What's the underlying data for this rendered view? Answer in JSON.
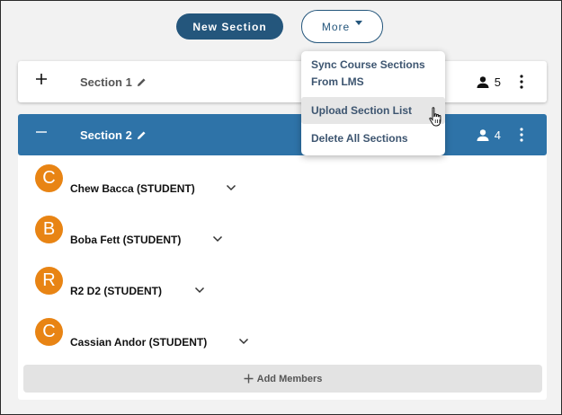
{
  "toolbar": {
    "new_section_label": "New Section",
    "more_label": "More"
  },
  "sections": [
    {
      "title": "Section 1",
      "member_count": "5",
      "expanded": false
    },
    {
      "title": "Section 2",
      "member_count": "4",
      "expanded": true
    }
  ],
  "members": [
    {
      "initial": "C",
      "name": "Chew Bacca (STUDENT)"
    },
    {
      "initial": "B",
      "name": "Boba Fett (STUDENT)"
    },
    {
      "initial": "R",
      "name": "R2 D2 (STUDENT)"
    },
    {
      "initial": "C",
      "name": "Cassian Andor (STUDENT)"
    }
  ],
  "add_members_label": "Add Members",
  "more_menu": {
    "items": [
      {
        "label_line1": "Sync Course Sections",
        "label_line2": "From LMS"
      },
      {
        "label": "Upload Section List"
      },
      {
        "label": "Delete All Sections"
      }
    ],
    "hovered_item": "Upload Section List"
  },
  "colors": {
    "primary": "#24567c",
    "section_active_bg": "#2e73a8",
    "avatar": "#e88414"
  },
  "icons": {
    "expand": "plus-icon",
    "collapse": "minus-icon",
    "edit": "pencil-icon",
    "members": "person-icon",
    "options": "kebab-icon",
    "member_toggle": "chevron-down-icon",
    "add": "plus-icon",
    "cursor": "hand-pointer-icon"
  }
}
